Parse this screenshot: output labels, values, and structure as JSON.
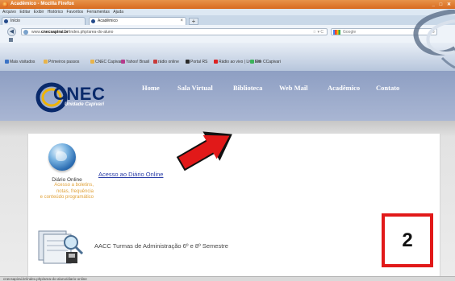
{
  "window": {
    "title": "Acadêmico - Mozilla Firefox",
    "controls": "_ □ ✕"
  },
  "menu": [
    "Arquivo",
    "Editar",
    "Exibir",
    "Histórico",
    "Favoritos",
    "Ferramentas",
    "Ajuda"
  ],
  "tabs": [
    {
      "label": "Início",
      "active": false
    },
    {
      "label": "Acadêmico",
      "active": true
    }
  ],
  "newtab_label": "+",
  "navbar": {
    "back_label": "◀",
    "url_prefix": "www.",
    "url_domain": "cnecsapirai.br",
    "url_path": "/index.php/area-do-aluno",
    "url_extra": "☆ ▾ C",
    "search_placeholder": "Google",
    "search_icon": "magnifier-icon"
  },
  "bookmarks": [
    "Mais visitados",
    "Primeiros passos",
    "CNEC Capivari",
    "Yahoo! Brasil",
    "rádio online",
    "Portal RS",
    "Rádio ao vivo | Live FM",
    "Site CCapivari"
  ],
  "site": {
    "logo_text": "CNEC",
    "logo_sub": "Unidade Capivari",
    "nav": [
      "Home",
      "Sala Virtual",
      "Biblioteca",
      "Web Mail",
      "Acadêmico",
      "Contato"
    ]
  },
  "content": {
    "diario_title": "Diário Online",
    "diario_desc": [
      "Acesso a boletins,",
      "notas, frequência",
      "e conteúdo programático"
    ],
    "diario_link": "Acesso ao Diário Online",
    "aacc_link": "AACC Turmas de Administração 6º e 8º Semestre"
  },
  "annotation": {
    "badge": "2",
    "arrow_color": "#e11919"
  },
  "statusbar": "cnecsapirai.br/index.php/area-do-aluno/diario-online"
}
